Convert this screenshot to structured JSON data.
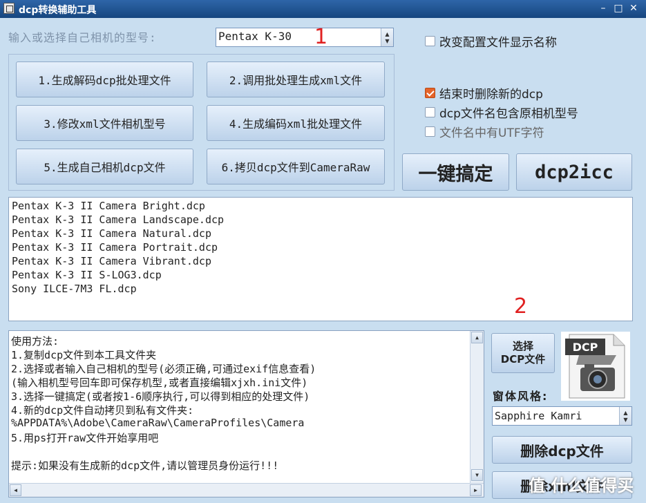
{
  "window": {
    "title": "dcp转换辅助工具",
    "minimize": "–",
    "maximize": "□",
    "close": "✕"
  },
  "model": {
    "label": "输入或选择自己相机的型号:",
    "value": "Pentax K-30"
  },
  "annotations": {
    "one": "1",
    "two": "2"
  },
  "steps": [
    "1.生成解码dcp批处理文件",
    "2.调用批处理生成xml文件",
    "3.修改xml文件相机型号",
    "4.生成编码xml批处理文件",
    "5.生成自己相机dcp文件",
    "6.拷贝dcp文件到CameraRaw"
  ],
  "options": {
    "rename_display": "改变配置文件显示名称",
    "delete_new_dcp": "结束时删除新的dcp",
    "include_model": "dcp文件名包含原相机型号",
    "utf_chars": "文件名中有UTF字符"
  },
  "big_buttons": {
    "one_key": "一键搞定",
    "dcp2icc": "dcp2icc"
  },
  "file_list": [
    "Pentax K-3 II Camera Bright.dcp",
    "Pentax K-3 II Camera Landscape.dcp",
    "Pentax K-3 II Camera Natural.dcp",
    "Pentax K-3 II Camera Portrait.dcp",
    "Pentax K-3 II Camera Vibrant.dcp",
    "Pentax K-3 II S-LOG3.dcp",
    "Sony ILCE-7M3 FL.dcp"
  ],
  "instructions": [
    "使用方法:",
    "1.复制dcp文件到本工具文件夹",
    "2.选择或者输入自己相机的型号(必须正确,可通过exif信息查看)",
    " (输入相机型号回车即可保存机型,或者直接编辑xjxh.ini文件)",
    "3.选择一键搞定(或者按1-6顺序执行,可以得到相应的处理文件)",
    "4.新的dcp文件自动拷贝到私有文件夹:",
    "  %APPDATA%\\Adobe\\CameraRaw\\CameraProfiles\\Camera",
    "5.用ps打开raw文件开始享用吧",
    "",
    "提示:如果没有生成新的dcp文件,请以管理员身份运行!!!"
  ],
  "select_dcp": {
    "line1": "选择",
    "line2": "DCP文件"
  },
  "dcp_icon_text": "DCP",
  "style": {
    "label": "窗体风格:",
    "value": "Sapphire Kamri"
  },
  "delete_buttons": {
    "delete_dcp": "删除dcp文件",
    "delete_xml": "删除xml文件"
  },
  "watermark": "值 什么值得买"
}
